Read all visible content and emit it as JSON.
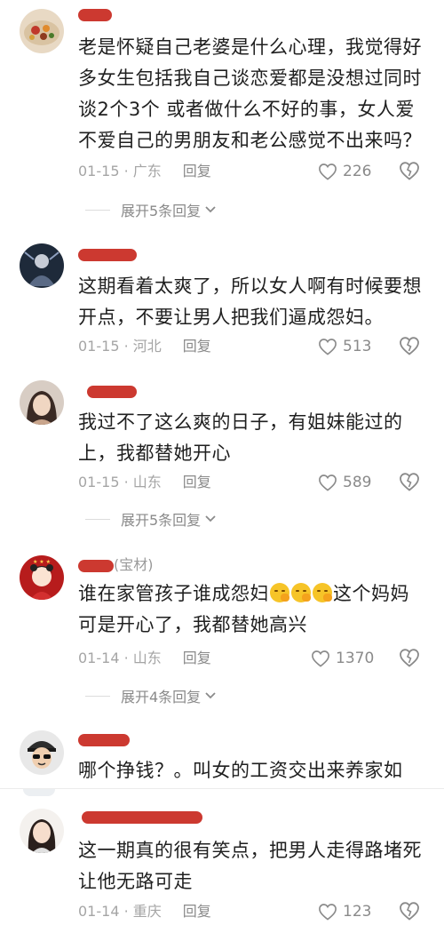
{
  "comments": [
    {
      "text": "老是怀疑自己老婆是什么心理，我觉得好多女生包括我自己谈恋爱都是没想过同时谈2个3个 或者做什么不好的事，女人爱不爱自己的男朋友和老公感觉不出来吗？",
      "date_loc": "01-15 · 广东",
      "reply": "回复",
      "likes": "226",
      "expand": "展开5条回复"
    },
    {
      "text": "这期看着太爽了，所以女人啊有时候要想开点，不要让男人把我们逼成怨妇。",
      "date_loc": "01-15 · 河北",
      "reply": "回复",
      "likes": "513"
    },
    {
      "text": "我过不了这么爽的日子，有姐妹能过的上，我都替她开心",
      "date_loc": "01-15 · 山东",
      "reply": "回复",
      "likes": "589",
      "expand": "展开5条回复"
    },
    {
      "username_suffix": "(宝材)",
      "text_before": "谁在家管孩子谁成怨妇",
      "text_after": "这个妈妈可是开心了，我都替她高兴",
      "date_loc": "01-14 · 山东",
      "reply": "回复",
      "likes": "1370",
      "expand": "展开4条回复"
    },
    {
      "text": "哪个挣钱？。叫女的工资交出来养家如",
      "date_loc": "",
      "reply": "",
      "likes": ""
    },
    {
      "text": "这一期真的很有笑点，把男人走得路堵死让他无路可走",
      "date_loc": "01-14 · 重庆",
      "reply": "回复",
      "likes": "123"
    }
  ]
}
